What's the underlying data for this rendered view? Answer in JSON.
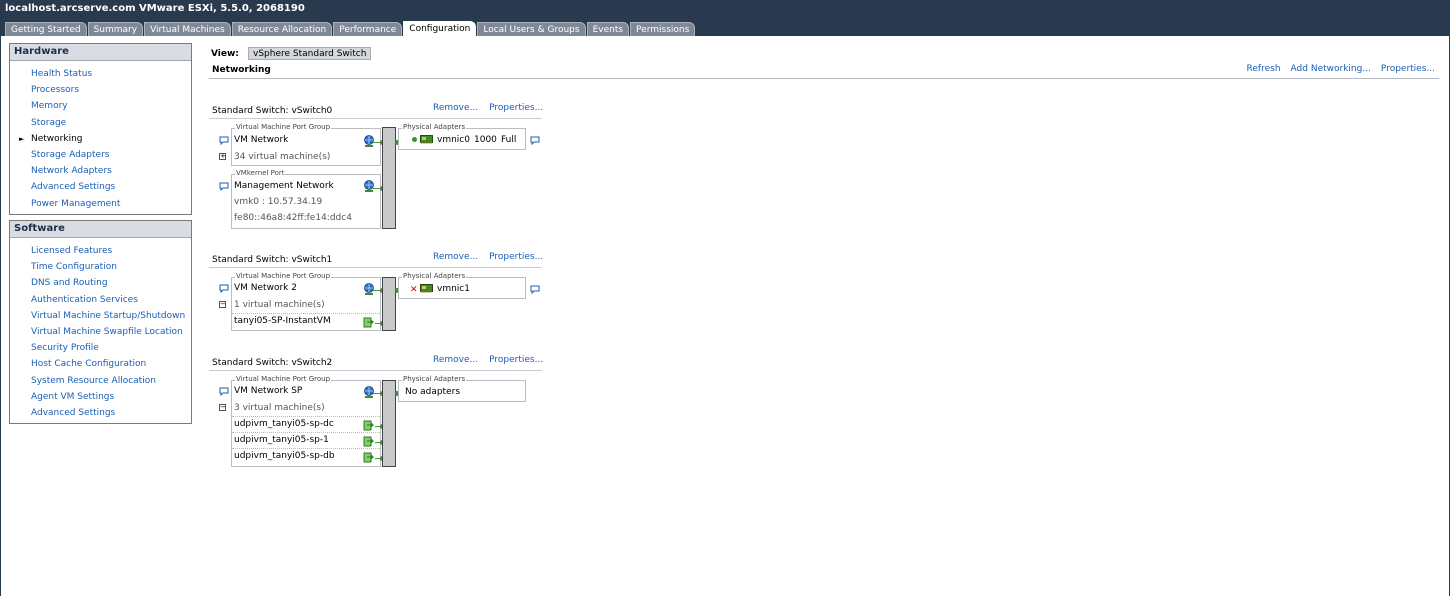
{
  "window": {
    "title": "localhost.arcserve.com VMware ESXi, 5.5.0, 2068190"
  },
  "tabs": [
    {
      "label": "Getting Started"
    },
    {
      "label": "Summary"
    },
    {
      "label": "Virtual Machines"
    },
    {
      "label": "Resource Allocation"
    },
    {
      "label": "Performance"
    },
    {
      "label": "Configuration",
      "active": true
    },
    {
      "label": "Local Users & Groups"
    },
    {
      "label": "Events"
    },
    {
      "label": "Permissions"
    }
  ],
  "hardware": {
    "header": "Hardware",
    "items": [
      {
        "label": "Health Status"
      },
      {
        "label": "Processors"
      },
      {
        "label": "Memory"
      },
      {
        "label": "Storage"
      },
      {
        "label": "Networking",
        "selected": true
      },
      {
        "label": "Storage Adapters"
      },
      {
        "label": "Network Adapters"
      },
      {
        "label": "Advanced Settings"
      },
      {
        "label": "Power Management"
      }
    ]
  },
  "software": {
    "header": "Software",
    "items": [
      {
        "label": "Licensed Features"
      },
      {
        "label": "Time Configuration"
      },
      {
        "label": "DNS and Routing"
      },
      {
        "label": "Authentication Services"
      },
      {
        "label": "Virtual Machine Startup/Shutdown"
      },
      {
        "label": "Virtual Machine Swapfile Location"
      },
      {
        "label": "Security Profile"
      },
      {
        "label": "Host Cache Configuration"
      },
      {
        "label": "System Resource Allocation"
      },
      {
        "label": "Agent VM Settings"
      },
      {
        "label": "Advanced Settings"
      }
    ]
  },
  "main": {
    "view_label": "View:",
    "view_value": "vSphere Standard Switch",
    "section_title": "Networking",
    "refresh": "Refresh",
    "add_networking": "Add Networking...",
    "properties": "Properties..."
  },
  "switches": [
    {
      "title": "Standard Switch: vSwitch0",
      "remove": "Remove...",
      "properties": "Properties...",
      "vm_group": {
        "legend": "Virtual Machine Port Group",
        "name": "VM Network",
        "count": "34 virtual machine(s)"
      },
      "vmk_group": {
        "legend": "VMkernel Port",
        "name": "Management Network",
        "ip": "vmk0 : 10.57.34.19",
        "ipv6": "fe80::46a8:42ff:fe14:ddc4"
      },
      "physical": {
        "legend": "Physical Adapters",
        "nic": "vmnic0",
        "speed": "1000",
        "duplex": "Full"
      }
    },
    {
      "title": "Standard Switch: vSwitch1",
      "remove": "Remove...",
      "properties": "Properties...",
      "vm_group": {
        "legend": "Virtual Machine Port Group",
        "name": "VM Network 2",
        "count": "1 virtual machine(s)",
        "vms": [
          "tanyi05-SP-InstantVM"
        ]
      },
      "physical": {
        "legend": "Physical Adapters",
        "nic": "vmnic1"
      }
    },
    {
      "title": "Standard Switch: vSwitch2",
      "remove": "Remove...",
      "properties": "Properties...",
      "vm_group": {
        "legend": "Virtual Machine Port Group",
        "name": "VM Network SP",
        "count": "3 virtual machine(s)",
        "vms": [
          "udpivm_tanyi05-sp-dc",
          "udpivm_tanyi05-sp-1",
          "udpivm_tanyi05-sp-db"
        ]
      },
      "physical": {
        "legend": "Physical Adapters",
        "none": "No adapters"
      }
    }
  ],
  "colors": {
    "titlebar": "#2a3a4e",
    "link": "#1a5fb4",
    "connector": "#3d8f2c"
  }
}
